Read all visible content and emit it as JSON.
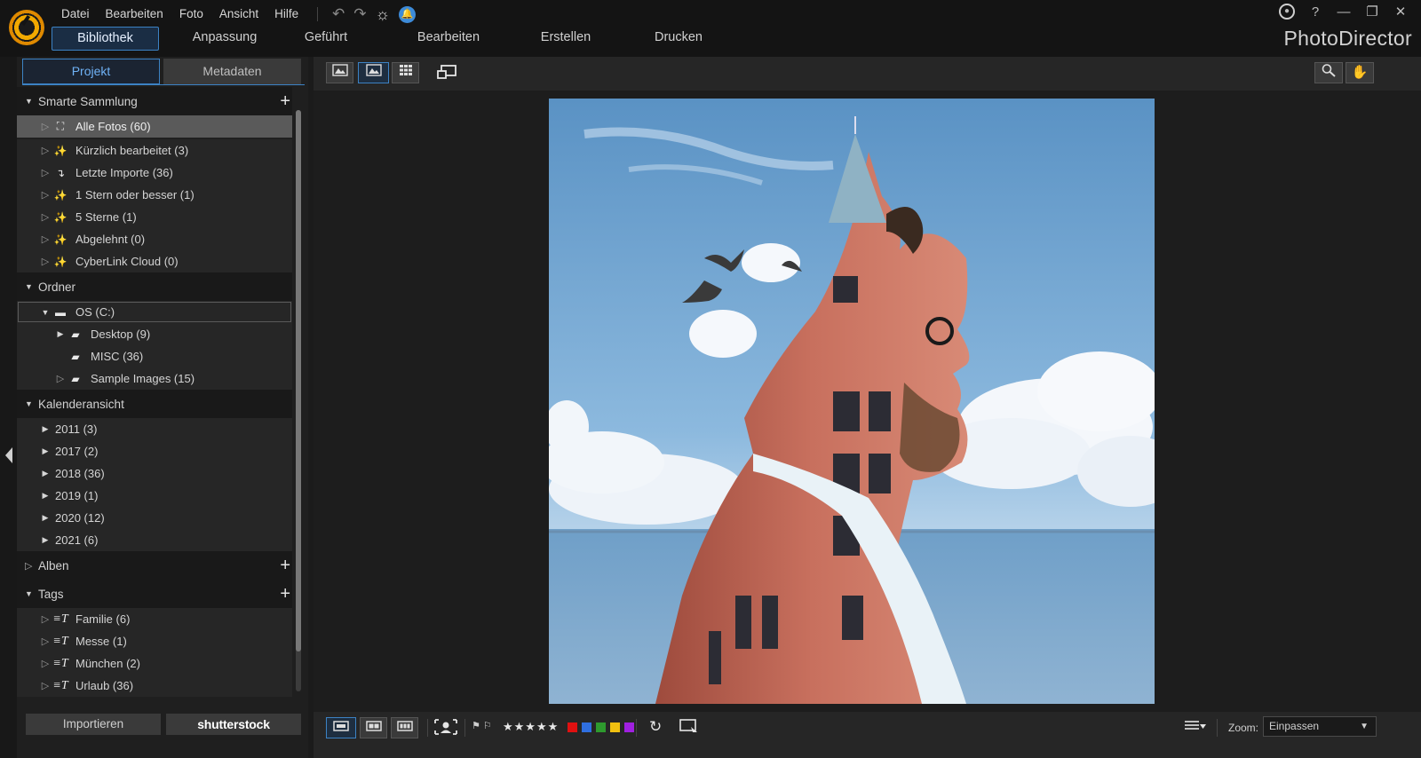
{
  "menu": [
    "Datei",
    "Bearbeiten",
    "Foto",
    "Ansicht",
    "Hilfe"
  ],
  "titlebar_icons": {
    "undo": "↶",
    "redo": "↷",
    "settings": "☼",
    "notifications": "🔔"
  },
  "window_controls": {
    "user": "👤",
    "help": "?",
    "minimize": "—",
    "restore": "❐",
    "close": "✕"
  },
  "modules": [
    {
      "label": "Bibliothek",
      "active": true
    },
    {
      "label": "Anpassung"
    },
    {
      "label": "Geführt"
    },
    {
      "label": "Bearbeiten"
    },
    {
      "label": "Erstellen"
    },
    {
      "label": "Drucken"
    }
  ],
  "brand": "PhotoDirector",
  "panel_tabs": {
    "project": "Projekt",
    "metadata": "Metadaten"
  },
  "smart_collection": {
    "title": "Smarte Sammlung",
    "items": [
      "Alle Fotos (60)",
      "Kürzlich bearbeitet (3)",
      "Letzte Importe (36)",
      "1 Stern oder besser (1)",
      "5 Sterne (1)",
      "Abgelehnt (0)",
      "CyberLink Cloud (0)"
    ]
  },
  "folders": {
    "title": "Ordner",
    "drive": "OS (C:)",
    "items": [
      "Desktop (9)",
      "MISC (36)",
      "Sample Images (15)"
    ]
  },
  "calendar": {
    "title": "Kalenderansicht",
    "items": [
      "2011 (3)",
      "2017 (2)",
      "2018 (36)",
      "2019 (1)",
      "2020 (12)",
      "2021 (6)"
    ]
  },
  "albums": {
    "title": "Alben"
  },
  "tags": {
    "title": "Tags",
    "items": [
      "Familie (6)",
      "Messe (1)",
      "München (2)",
      "Urlaub (36)"
    ]
  },
  "bottom_buttons": {
    "import": "Importieren",
    "shutterstock": "shutterstock"
  },
  "status": {
    "stars": "★★★★★",
    "color_labels": [
      "#e01010",
      "#2f6fe0",
      "#2e9a2e",
      "#f0c010",
      "#a020e0"
    ],
    "zoom_label": "Zoom:",
    "zoom_value": "Einpassen"
  }
}
